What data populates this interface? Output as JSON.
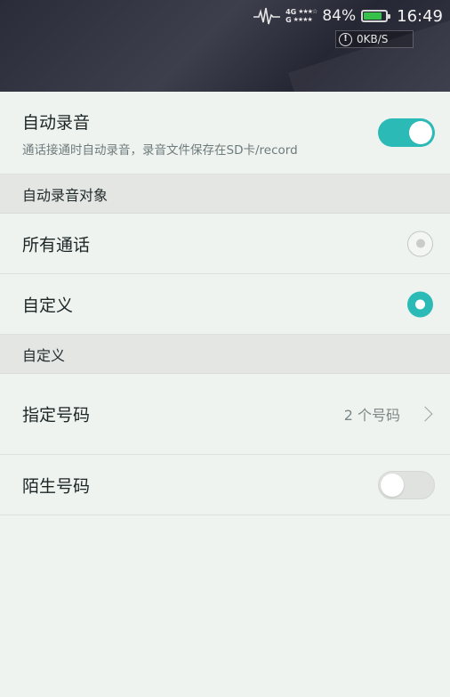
{
  "status_bar": {
    "network_top": "4G",
    "network_bottom": "G",
    "stars_top": "★★★☆",
    "stars_bottom": "★★★★",
    "battery_percent": "84%",
    "battery_level": 0.84,
    "time": "16:49",
    "net_speed": "0KB/S",
    "info_glyph": "!"
  },
  "auto_record": {
    "title": "自动录音",
    "subtitle": "通话接通时自动录音，录音文件保存在SD卡/record",
    "enabled": true
  },
  "target_section": {
    "header": "自动录音对象",
    "options": [
      {
        "label": "所有通话",
        "selected": false
      },
      {
        "label": "自定义",
        "selected": true
      }
    ]
  },
  "custom_section": {
    "header": "自定义",
    "specified_numbers": {
      "label": "指定号码",
      "value": "2 个号码"
    },
    "unknown_numbers": {
      "label": "陌生号码",
      "enabled": false
    }
  },
  "colors": {
    "accent": "#2bbab6",
    "background": "#eff3ef",
    "section_header": "#e4e6e4"
  }
}
